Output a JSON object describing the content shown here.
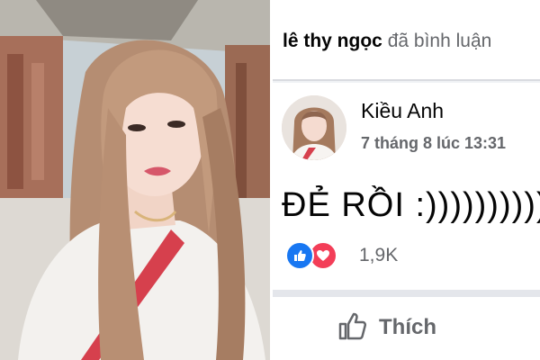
{
  "post": {
    "header_name": "lê thy ngọc",
    "header_action": "đã bình luận"
  },
  "comment": {
    "author": "Kiều Anh",
    "timestamp": "7 tháng 8 lúc 13:31",
    "text": "ĐẺ RỒI :))))))))))",
    "reaction_count": "1,9K",
    "reactions": [
      "like-icon",
      "love-icon"
    ]
  },
  "actions": {
    "like_label": "Thích"
  },
  "colors": {
    "like_blue": "#1877f2",
    "love_red": "#f33e58",
    "secondary_text": "#65676b",
    "panel_bg": "#f0f2f5"
  }
}
